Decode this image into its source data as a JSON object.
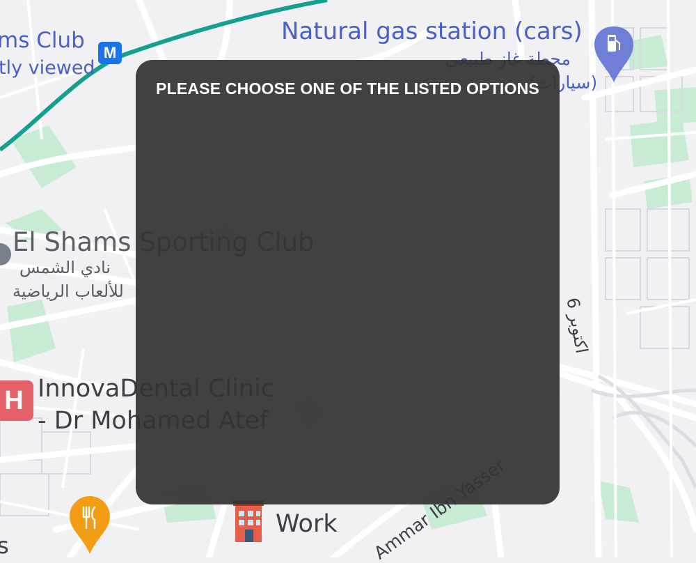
{
  "map": {
    "labels": {
      "sports_club_fragment": "ms Club",
      "recently_viewed_fragment": "tly viewed",
      "gas_station_en": "Natural gas station (cars)",
      "gas_station_ar_line1": "محطة غاز طبيعي",
      "gas_station_ar_line2": "(سيارات)",
      "el_shams_en": "El Shams Sporting Club",
      "el_shams_ar_line1": "نادي الشمس",
      "el_shams_ar_line2": "للألعاب الرياضية",
      "street_6_october": "6 اكتوبر",
      "clinic_line1": "InnovaDental Clinic",
      "clinic_line2": "- Dr Mohamed Atef",
      "work": "Work",
      "street_ammar": "Ammar Ibn Yasser",
      "edge_letter": "s",
      "metro_letter": "M",
      "hospital_letter": "H"
    },
    "icons": [
      "metro-icon",
      "gas-station-icon",
      "hospital-icon",
      "restaurant-icon",
      "work-building-icon",
      "place-pin-icon"
    ],
    "colors": {
      "background": "#f1f1f4",
      "roads": "#ffffff",
      "road_outline": "#d5d8de",
      "parks": "#c7ecd3",
      "transit_line": "#14a08f",
      "poi_blue": "#4a5fc7",
      "gas_pin": "#6f7ed6",
      "hospital": "#e5616a",
      "restaurant": "#f29d14"
    }
  },
  "dialog": {
    "title": "PLEASE CHOOSE ONE OF THE LISTED OPTIONS",
    "background": "#343434",
    "text_color": "#ffffff"
  }
}
